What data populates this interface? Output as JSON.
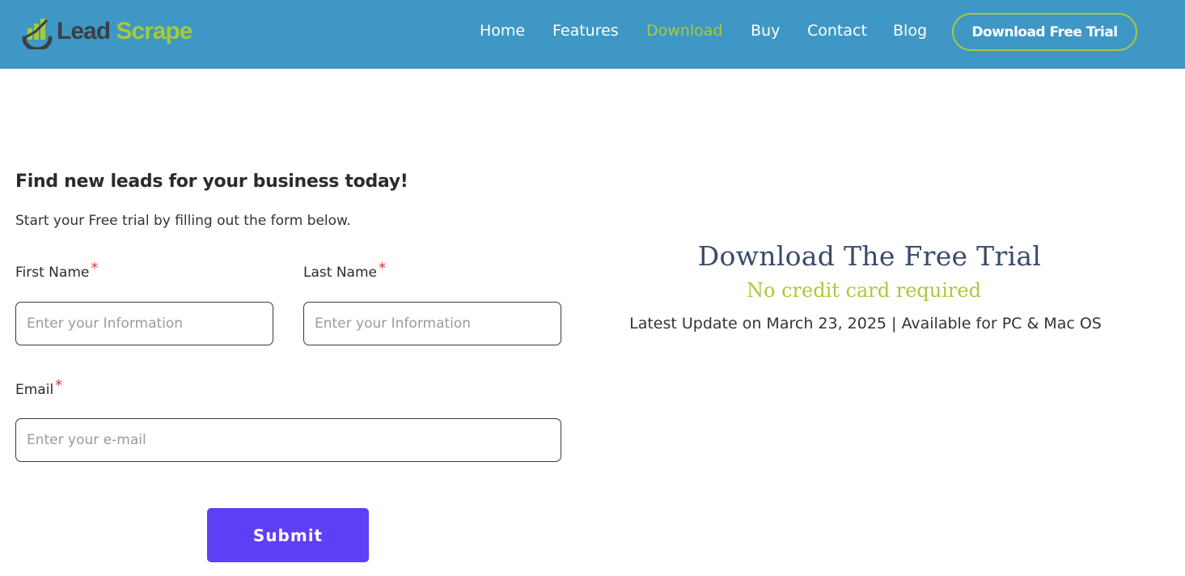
{
  "header": {
    "logo": {
      "lead": "Lead",
      "scrape": "Scrape"
    },
    "nav": [
      {
        "label": "Home",
        "active": false
      },
      {
        "label": "Features",
        "active": false
      },
      {
        "label": "Download",
        "active": true
      },
      {
        "label": "Buy",
        "active": false
      },
      {
        "label": "Contact",
        "active": false
      },
      {
        "label": "Blog",
        "active": false
      }
    ],
    "cta_label": "Download Free Trial"
  },
  "form": {
    "title": "Find new leads for your business today!",
    "subtitle": "Start your Free trial by filling out the form below.",
    "first_name": {
      "label": "First Name",
      "required_mark": "*",
      "placeholder": "Enter your Information"
    },
    "last_name": {
      "label": "Last Name",
      "required_mark": "*",
      "placeholder": "Enter your Information"
    },
    "email": {
      "label": "Email",
      "required_mark": "*",
      "placeholder": "Enter your e-mail"
    },
    "submit_label": "Submit"
  },
  "download": {
    "title": "Download The Free Trial",
    "subtitle": "No credit card required",
    "update_text": "Latest Update on March 23, 2025 | Available for PC & Mac OS"
  },
  "colors": {
    "header_bg": "#3e97c4",
    "accent_green": "#a8c93a",
    "submit_purple": "#5f3ff5",
    "required_red": "#e0353a"
  }
}
